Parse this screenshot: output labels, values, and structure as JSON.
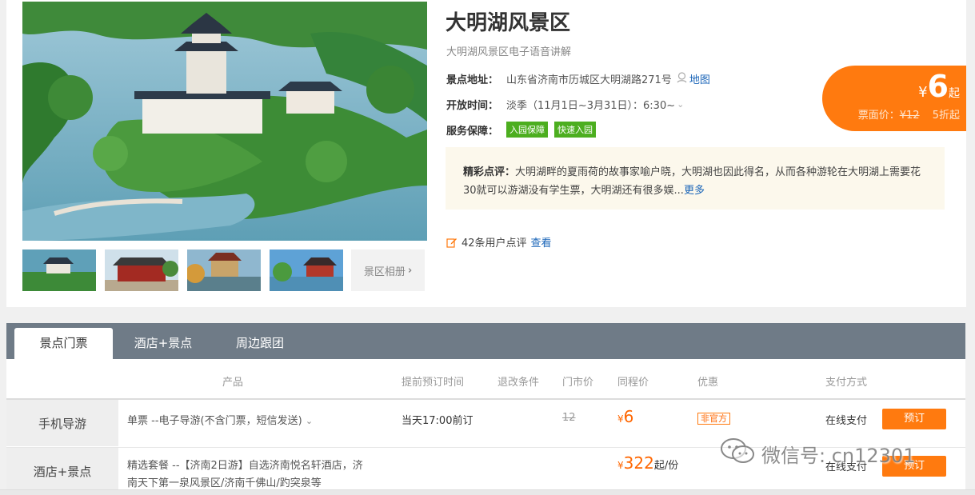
{
  "attraction": {
    "title": "大明湖风景区",
    "subtitle": "大明湖风景区电子语音讲解",
    "address_label": "景点地址：",
    "address": "山东省济南市历城区大明湖路271号",
    "map_link": "地图",
    "hours_label": "开放时间：",
    "hours": "淡季（11月1日~3月31日）：6:30~",
    "service_label": "服务保障：",
    "service_badges": [
      "入园保障",
      "快速入园"
    ],
    "album_button": "景区相册"
  },
  "price_tag": {
    "currency": "¥",
    "price": "6",
    "suffix": "起",
    "face_label": "票面价：",
    "face_price": "¥12",
    "discount": "5折起"
  },
  "review": {
    "label": "精彩点评：",
    "text": "大明湖畔的夏雨荷的故事家喻户晓，大明湖也因此得名，从而各种游轮在大明湖上需要花30就可以游湖没有学生票，大明湖还有很多娱...",
    "more": "更多",
    "count_text": "42条用户点评",
    "view_link": "查看"
  },
  "tabs": [
    "景点门票",
    "酒店+景点",
    "周边跟团"
  ],
  "table": {
    "headers": {
      "product": "产品",
      "advance": "提前预订时间",
      "refund": "退改条件",
      "door_price": "门市价",
      "tc_price": "同程价",
      "promo": "优惠",
      "payment": "支付方式"
    },
    "rows": [
      {
        "category": "手机导游",
        "product": "单票 --电子导游(不含门票，短信发送)",
        "advance": "当天17:00前订",
        "door_price": "12",
        "tc_currency": "¥",
        "tc_price": "6",
        "promo": "非官方",
        "payment": "在线支付",
        "book": "预订"
      },
      {
        "category": "酒店+景点",
        "product_line1": "精选套餐 --【济南2日游】自选济南悦名轩酒店，济",
        "product_line2": "南天下第一泉风景区/济南千佛山/趵突泉等",
        "tc_currency": "¥",
        "tc_price": "322",
        "tc_suffix": "起/份",
        "payment": "在线支付",
        "book": "预订"
      }
    ]
  },
  "watermark": "微信号: cn12301",
  "colors": {
    "accent": "#ff7a0f",
    "link": "#1a65b8",
    "badge_green": "#4cae1f",
    "tab_bar": "#6f7b87"
  }
}
